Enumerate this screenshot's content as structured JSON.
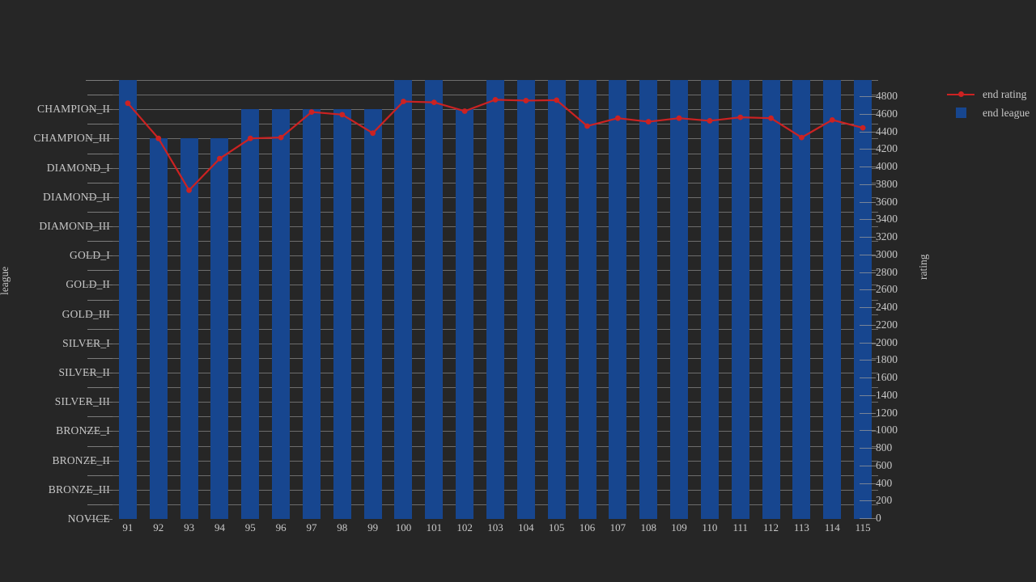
{
  "chart_data": {
    "type": "bar",
    "title": "",
    "xlabel": "",
    "ylabel": "league",
    "y2label": "rating",
    "grid": true,
    "legend_position": "right",
    "categories": [
      "91",
      "92",
      "93",
      "94",
      "95",
      "96",
      "97",
      "98",
      "99",
      "100",
      "101",
      "102",
      "103",
      "104",
      "105",
      "106",
      "107",
      "108",
      "109",
      "110",
      "111",
      "112",
      "113",
      "114",
      "115"
    ],
    "series": [
      {
        "name": "end league",
        "type": "bar",
        "color": "#17468f",
        "axis": "left",
        "values": [
          "CHAMPION_I",
          "CHAMPION_III",
          "CHAMPION_III",
          "CHAMPION_III",
          "CHAMPION_II",
          "CHAMPION_II",
          "CHAMPION_II",
          "CHAMPION_II",
          "CHAMPION_II",
          "CHAMPION_I",
          "CHAMPION_I",
          "CHAMPION_II",
          "CHAMPION_I",
          "CHAMPION_I",
          "CHAMPION_I",
          "CHAMPION_I",
          "CHAMPION_I",
          "CHAMPION_I",
          "CHAMPION_I",
          "CHAMPION_I",
          "CHAMPION_I",
          "CHAMPION_I",
          "CHAMPION_I",
          "CHAMPION_I",
          "CHAMPION_I"
        ]
      },
      {
        "name": "end rating",
        "type": "line",
        "color": "#cc2222",
        "axis": "right",
        "values": [
          4720,
          4320,
          3730,
          4090,
          4320,
          4330,
          4620,
          4590,
          4380,
          4740,
          4730,
          4630,
          4760,
          4750,
          4755,
          4460,
          4550,
          4510,
          4550,
          4520,
          4560,
          4550,
          4330,
          4530,
          4440
        ]
      }
    ],
    "left_axis": {
      "label": "league",
      "ticks": [
        "CHAMPION_II",
        "CHAMPION_III",
        "DIAMOND_I",
        "DIAMOND_II",
        "DIAMOND_III",
        "GOLD_I",
        "GOLD_II",
        "GOLD_III",
        "SILVER_I",
        "SILVER_II",
        "SILVER_III",
        "BRONZE_I",
        "BRONZE_II",
        "BRONZE_III",
        "NOVICE"
      ],
      "all_levels": [
        "CHAMPION_I",
        "CHAMPION_II",
        "CHAMPION_III",
        "DIAMOND_I",
        "DIAMOND_II",
        "DIAMOND_III",
        "GOLD_I",
        "GOLD_II",
        "GOLD_III",
        "SILVER_I",
        "SILVER_II",
        "SILVER_III",
        "BRONZE_I",
        "BRONZE_II",
        "BRONZE_III",
        "NOVICE"
      ]
    },
    "right_axis": {
      "label": "rating",
      "ylim": [
        0,
        4800
      ],
      "tick_step": 200,
      "ticks": [
        "4800",
        "4600",
        "4400",
        "4200",
        "4000",
        "3800",
        "3600",
        "3400",
        "3200",
        "3000",
        "2800",
        "2600",
        "2400",
        "2200",
        "2000",
        "1800",
        "1600",
        "1400",
        "1200",
        "1000",
        "800",
        "600",
        "400",
        "200",
        "0"
      ]
    },
    "legend": [
      {
        "label": "end rating",
        "marker": "line-marker",
        "color": "#cc2222"
      },
      {
        "label": "end league",
        "marker": "square",
        "color": "#17468f"
      }
    ],
    "colors": {
      "background": "#262626",
      "bar": "#17468f",
      "line": "#cc2222",
      "text": "#c8c8c8",
      "grid": "#9a9a9a"
    }
  }
}
